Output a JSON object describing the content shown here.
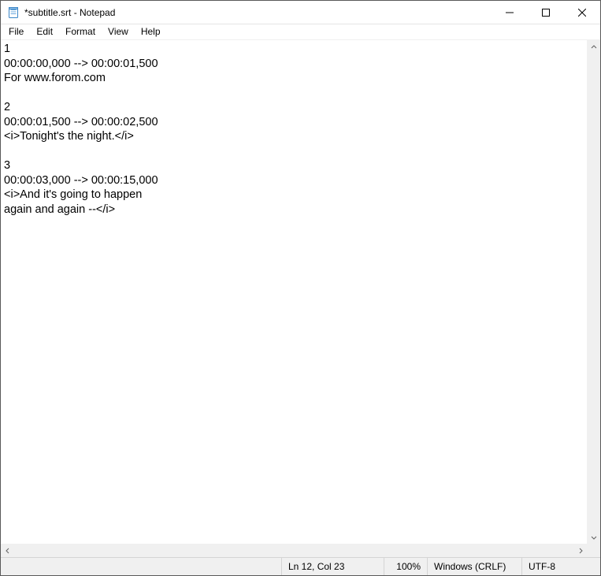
{
  "window": {
    "title": "*subtitle.srt - Notepad"
  },
  "menu": {
    "file": "File",
    "edit": "Edit",
    "format": "Format",
    "view": "View",
    "help": "Help"
  },
  "editor": {
    "content": "1\n00:00:00,000 --> 00:00:01,500\nFor www.forom.com\n\n2\n00:00:01,500 --> 00:00:02,500\n<i>Tonight's the night.</i>\n\n3\n00:00:03,000 --> 00:00:15,000\n<i>And it's going to happen\nagain and again --</i>"
  },
  "status": {
    "position": "Ln 12, Col 23",
    "zoom": "100%",
    "eol": "Windows (CRLF)",
    "encoding": "UTF-8"
  }
}
